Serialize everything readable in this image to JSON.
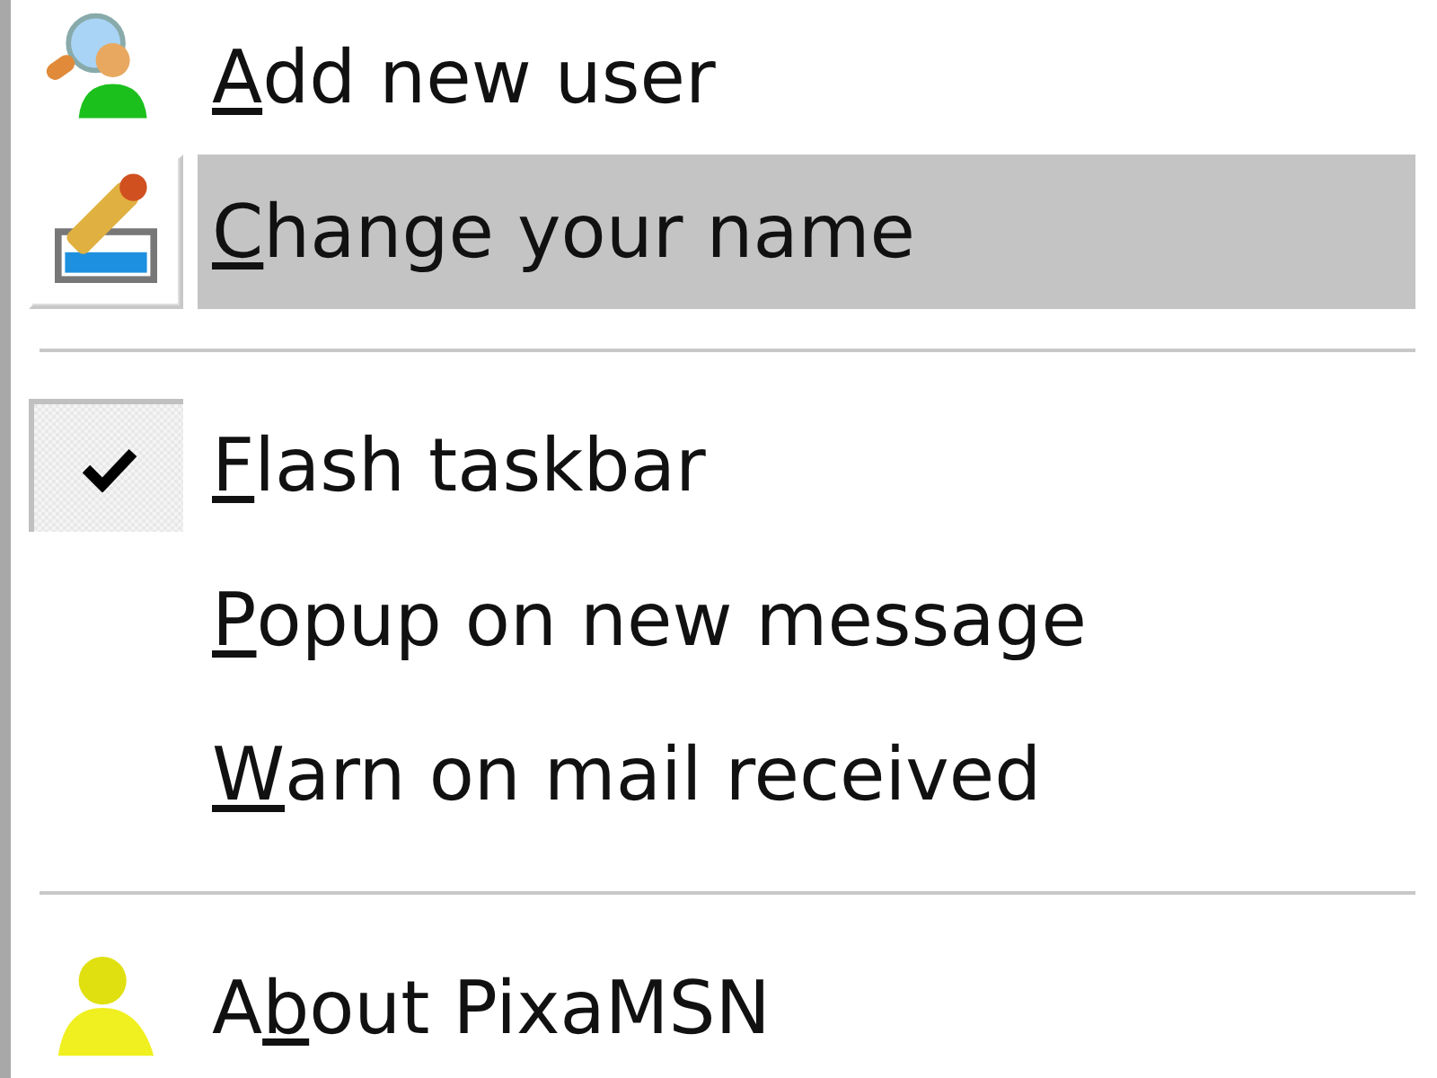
{
  "menu": {
    "items": [
      {
        "kind": "adduser",
        "access_key": "A",
        "label_after": "dd new user",
        "selected": false
      },
      {
        "kind": "rename",
        "access_key": "C",
        "label_after": "hange your name",
        "selected": true
      },
      {
        "kind": "separator"
      },
      {
        "kind": "check",
        "access_key": "F",
        "label_after": "lash taskbar",
        "checked": true,
        "selected": false
      },
      {
        "kind": "check",
        "access_key": "P",
        "label_after": "opup on new message",
        "checked": false,
        "selected": false
      },
      {
        "kind": "check",
        "access_key": "W",
        "label_after": "arn on mail received",
        "checked": false,
        "selected": false
      },
      {
        "kind": "separator"
      },
      {
        "kind": "about",
        "label_before": "A",
        "access_key": "b",
        "label_after": "out PixaMSN",
        "selected": false
      }
    ]
  }
}
